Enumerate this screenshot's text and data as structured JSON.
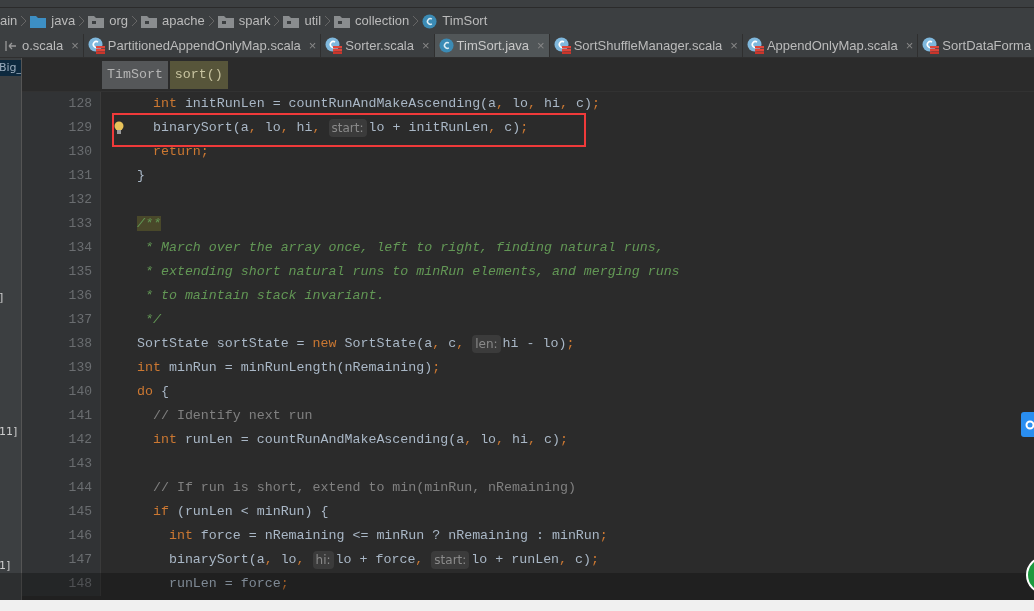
{
  "breadcrumbs": [
    {
      "text": "ain",
      "kind": "plain"
    },
    {
      "text": "java",
      "kind": "source_folder"
    },
    {
      "text": "org",
      "kind": "folder"
    },
    {
      "text": "apache",
      "kind": "folder"
    },
    {
      "text": "spark",
      "kind": "folder"
    },
    {
      "text": "util",
      "kind": "folder"
    },
    {
      "text": "collection",
      "kind": "folder"
    },
    {
      "text": "TimSort",
      "kind": "class"
    }
  ],
  "tabs": [
    {
      "label": "o.scala",
      "close": "×",
      "selected": false
    },
    {
      "label": "PartitionedAppendOnlyMap.scala",
      "kind": "scala",
      "close": "×",
      "selected": false
    },
    {
      "label": "Sorter.scala",
      "kind": "scala",
      "close": "×",
      "selected": false
    },
    {
      "label": "TimSort.java",
      "kind": "java",
      "close": "×",
      "selected": true
    },
    {
      "label": "SortShuffleManager.scala",
      "kind": "scala",
      "close": "×",
      "selected": false
    },
    {
      "label": "AppendOnlyMap.scala",
      "kind": "scala",
      "close": "×",
      "selected": false
    },
    {
      "label": "SortDataForma",
      "kind": "scala",
      "selected": false
    }
  ],
  "left_panel": [
    {
      "text": "Big_",
      "selected": true
    },
    {
      "text": "]",
      "selected": false
    },
    {
      "text": "11]",
      "selected": false
    },
    {
      "text": "1]",
      "selected": false
    }
  ],
  "editor_breadcrumbs": [
    {
      "text": "TimSort",
      "kind": "class"
    },
    {
      "text": "sort()",
      "kind": "method"
    }
  ],
  "lines": [
    {
      "number": "128",
      "tokens": [
        {
          "kind": "kw",
          "text": "  int"
        },
        {
          "kind": "code",
          "text": " initRunLen = countRunAndMakeAscending(a"
        },
        {
          "kind": "kw",
          "text": ","
        },
        {
          "kind": "code",
          "text": " lo"
        },
        {
          "kind": "kw",
          "text": ","
        },
        {
          "kind": "code",
          "text": " hi"
        },
        {
          "kind": "kw",
          "text": ","
        },
        {
          "kind": "code",
          "text": " c)"
        },
        {
          "kind": "kw",
          "text": ";"
        }
      ]
    },
    {
      "number": "129",
      "bulb": true,
      "tokens": [
        {
          "kind": "code",
          "text": "  binarySort(a"
        },
        {
          "kind": "kw",
          "text": ","
        },
        {
          "kind": "code",
          "text": " lo"
        },
        {
          "kind": "kw",
          "text": ","
        },
        {
          "kind": "code",
          "text": " hi"
        },
        {
          "kind": "kw",
          "text": ", "
        },
        {
          "kind": "hint",
          "text": "start:"
        },
        {
          "kind": "code",
          "text": "lo + initRunLen"
        },
        {
          "kind": "kw",
          "text": ","
        },
        {
          "kind": "code",
          "text": " c)"
        },
        {
          "kind": "kw",
          "text": ";"
        }
      ]
    },
    {
      "number": "130",
      "tokens": [
        {
          "kind": "kw",
          "text": "  return;"
        }
      ]
    },
    {
      "number": "131",
      "tokens": [
        {
          "kind": "code",
          "text": "}"
        }
      ]
    },
    {
      "number": "132"
    },
    {
      "number": "133",
      "tokens": [
        {
          "kind": "doc_mark",
          "text": "/**"
        }
      ]
    },
    {
      "number": "134",
      "tokens": [
        {
          "kind": "doc",
          "text": " * March over the array once, left to right, finding natural runs,"
        }
      ]
    },
    {
      "number": "135",
      "tokens": [
        {
          "kind": "doc",
          "text": " * extending short natural runs to minRun elements, and merging runs"
        }
      ]
    },
    {
      "number": "136",
      "tokens": [
        {
          "kind": "doc",
          "text": " * to maintain stack invariant."
        }
      ]
    },
    {
      "number": "137",
      "tokens": [
        {
          "kind": "doc",
          "text": " */"
        }
      ]
    },
    {
      "number": "138",
      "tokens": [
        {
          "kind": "code",
          "text": "SortState sortState = "
        },
        {
          "kind": "kw",
          "text": "new"
        },
        {
          "kind": "code",
          "text": " SortState(a"
        },
        {
          "kind": "kw",
          "text": ","
        },
        {
          "kind": "code",
          "text": " c"
        },
        {
          "kind": "kw",
          "text": ", "
        },
        {
          "kind": "hint",
          "text": "len:"
        },
        {
          "kind": "code",
          "text": "hi - lo)"
        },
        {
          "kind": "kw",
          "text": ";"
        }
      ]
    },
    {
      "number": "139",
      "tokens": [
        {
          "kind": "kw",
          "text": "int"
        },
        {
          "kind": "code",
          "text": " minRun = minRunLength(nRemaining)"
        },
        {
          "kind": "kw",
          "text": ";"
        }
      ]
    },
    {
      "number": "140",
      "tokens": [
        {
          "kind": "kw",
          "text": "do"
        },
        {
          "kind": "code",
          "text": " {"
        }
      ]
    },
    {
      "number": "141",
      "tokens": [
        {
          "kind": "comment",
          "text": "  // Identify next run"
        }
      ]
    },
    {
      "number": "142",
      "tokens": [
        {
          "kind": "kw",
          "text": "  int"
        },
        {
          "kind": "code",
          "text": " runLen = countRunAndMakeAscending(a"
        },
        {
          "kind": "kw",
          "text": ","
        },
        {
          "kind": "code",
          "text": " lo"
        },
        {
          "kind": "kw",
          "text": ","
        },
        {
          "kind": "code",
          "text": " hi"
        },
        {
          "kind": "kw",
          "text": ","
        },
        {
          "kind": "code",
          "text": " c)"
        },
        {
          "kind": "kw",
          "text": ";"
        }
      ]
    },
    {
      "number": "143"
    },
    {
      "number": "144",
      "tokens": [
        {
          "kind": "comment",
          "text": "  // If run is short, extend to min(minRun, nRemaining)"
        }
      ]
    },
    {
      "number": "145",
      "tokens": [
        {
          "kind": "kw",
          "text": "  if"
        },
        {
          "kind": "code",
          "text": " (runLen < minRun) {"
        }
      ]
    },
    {
      "number": "146",
      "tokens": [
        {
          "kind": "kw",
          "text": "    int"
        },
        {
          "kind": "code",
          "text": " force = nRemaining <= minRun ? nRemaining : minRun"
        },
        {
          "kind": "kw",
          "text": ";"
        }
      ]
    },
    {
      "number": "147",
      "tokens": [
        {
          "kind": "code",
          "text": "    binarySort(a"
        },
        {
          "kind": "kw",
          "text": ","
        },
        {
          "kind": "code",
          "text": " lo"
        },
        {
          "kind": "kw",
          "text": ", "
        },
        {
          "kind": "hint",
          "text": "hi:"
        },
        {
          "kind": "code",
          "text": "lo + force"
        },
        {
          "kind": "kw",
          "text": ", "
        },
        {
          "kind": "hint",
          "text": "start:"
        },
        {
          "kind": "code",
          "text": "lo + runLen"
        },
        {
          "kind": "kw",
          "text": ","
        },
        {
          "kind": "code",
          "text": " c)"
        },
        {
          "kind": "kw",
          "text": ";"
        }
      ]
    },
    {
      "number": "148",
      "tokens": [
        {
          "kind": "code",
          "text": "    runLen = force"
        },
        {
          "kind": "kw",
          "text": ";"
        }
      ]
    }
  ]
}
